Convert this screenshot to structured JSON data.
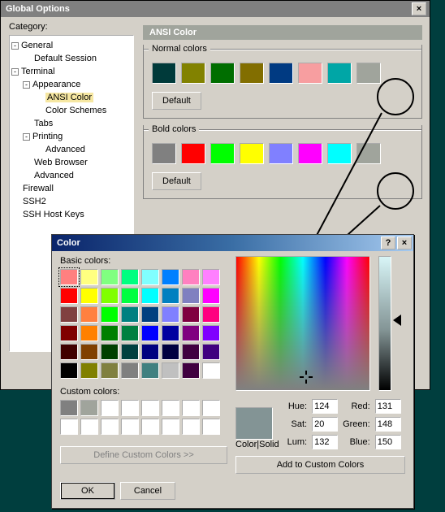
{
  "global_options": {
    "title": "Global Options",
    "category_label": "Category:",
    "tree": {
      "general": "General",
      "default_session": "Default Session",
      "terminal": "Terminal",
      "appearance": "Appearance",
      "ansi_color": "ANSI Color",
      "color_schemes": "Color Schemes",
      "tabs": "Tabs",
      "printing": "Printing",
      "advanced1": "Advanced",
      "web_browser": "Web Browser",
      "advanced2": "Advanced",
      "firewall": "Firewall",
      "ssh2": "SSH2",
      "ssh_host_keys": "SSH Host Keys"
    },
    "section_header": "ANSI Color",
    "normal_group": {
      "title": "Normal colors",
      "colors": [
        "#003a3a",
        "#828200",
        "#006e00",
        "#826e00",
        "#003a82",
        "#f79ea0",
        "#00a6a6",
        "#a0a49c"
      ],
      "default_btn": "Default"
    },
    "bold_group": {
      "title": "Bold colors",
      "colors": [
        "#808080",
        "#ff0000",
        "#00ff00",
        "#ffff00",
        "#8080ff",
        "#ff00ff",
        "#00ffff",
        "#a0a49c"
      ],
      "default_btn": "Default"
    }
  },
  "color_dialog": {
    "title": "Color",
    "basic_label": "Basic colors:",
    "basic_colors": [
      "#ff8080",
      "#ffff80",
      "#80ff80",
      "#00ff80",
      "#80ffff",
      "#0080ff",
      "#ff80c0",
      "#ff80ff",
      "#ff0000",
      "#ffff00",
      "#80ff00",
      "#00ff40",
      "#00ffff",
      "#0080c0",
      "#8080c0",
      "#ff00ff",
      "#804040",
      "#ff8040",
      "#00ff00",
      "#008080",
      "#004080",
      "#8080ff",
      "#800040",
      "#ff0080",
      "#800000",
      "#ff8000",
      "#008000",
      "#008040",
      "#0000ff",
      "#0000a0",
      "#800080",
      "#8000ff",
      "#400000",
      "#804000",
      "#004000",
      "#004040",
      "#000080",
      "#000040",
      "#400040",
      "#400080",
      "#000000",
      "#808000",
      "#808040",
      "#808080",
      "#408080",
      "#c0c0c0",
      "#400040",
      "#ffffff"
    ],
    "basic_selected": 0,
    "custom_label": "Custom colors:",
    "custom_colors": [
      "#808080",
      "#a0a49c",
      "#ffffff",
      "#ffffff",
      "#ffffff",
      "#ffffff",
      "#ffffff",
      "#ffffff",
      "#ffffff",
      "#ffffff",
      "#ffffff",
      "#ffffff",
      "#ffffff",
      "#ffffff",
      "#ffffff",
      "#ffffff"
    ],
    "define_btn": "Define Custom Colors >>",
    "color_solid_label": "Color|Solid",
    "hue_label": "Hue:",
    "hue": "124",
    "sat_label": "Sat:",
    "sat": "20",
    "lum_label": "Lum:",
    "lum": "132",
    "red_label": "Red:",
    "red": "131",
    "green_label": "Green:",
    "green": "148",
    "blue_label": "Blue:",
    "blue": "150",
    "add_btn": "Add to Custom Colors",
    "ok": "OK",
    "cancel": "Cancel",
    "help": "?",
    "close": "×"
  }
}
